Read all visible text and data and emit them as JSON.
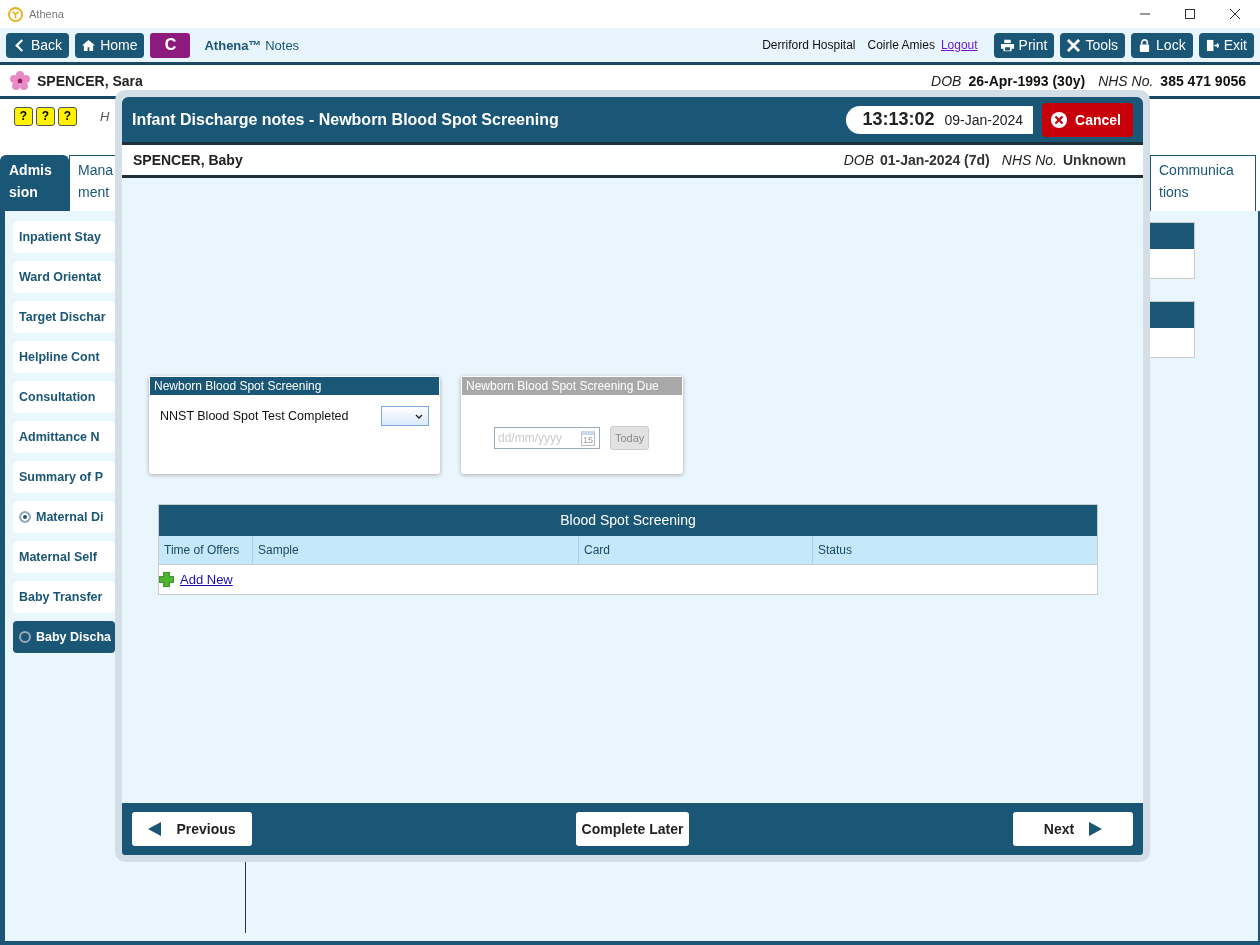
{
  "window": {
    "title": "Athena"
  },
  "toolbar": {
    "back": "Back",
    "home": "Home",
    "badge": "C",
    "app_name": "**Athena™** Notes",
    "hospital": "Derriford Hospital",
    "user": "Coirle Amies",
    "logout": "Logout",
    "buttons": [
      {
        "label": "Print",
        "kind": "print"
      },
      {
        "label": "Tools",
        "kind": "tools"
      },
      {
        "label": "Lock",
        "kind": "lock"
      },
      {
        "label": "Exit",
        "kind": "exit"
      }
    ]
  },
  "patient": {
    "name": "SPENCER, Sara",
    "dob_label": "DOB",
    "dob": "26-Apr-1993 (30y)",
    "nhs_label": "NHS No.",
    "nhs": "385 471 9056"
  },
  "alert_icons": [
    "?",
    "?",
    "?"
  ],
  "header_hint": "H",
  "tabs": [
    {
      "lines": [
        "Admis",
        "sion"
      ],
      "selected": true
    },
    {
      "lines": [
        "Mana",
        "ment"
      ],
      "selected": false
    },
    {
      "lines": [
        "Communica",
        "tions"
      ],
      "selected": false
    }
  ],
  "sidebar": {
    "items": [
      {
        "label": "Inpatient Stay",
        "kind": "plain",
        "selected": false
      },
      {
        "label": "Ward Orientat",
        "kind": "plain",
        "selected": false
      },
      {
        "label": "Target Dischar",
        "kind": "plain",
        "selected": false
      },
      {
        "label": "Helpline Cont",
        "kind": "plain",
        "selected": false
      },
      {
        "label": "Consultation",
        "kind": "plain",
        "selected": false
      },
      {
        "label": "Admittance N",
        "kind": "plain",
        "selected": false
      },
      {
        "label": "Summary of P",
        "kind": "plain",
        "selected": false
      },
      {
        "label": "Maternal Di",
        "kind": "radio",
        "checked": true,
        "selected": false
      },
      {
        "label": "Maternal Self",
        "kind": "plain",
        "selected": false
      },
      {
        "label": "Baby Transfer",
        "kind": "plain",
        "selected": false
      },
      {
        "label": "Baby Discha",
        "kind": "radio",
        "checked": false,
        "selected": true
      }
    ]
  },
  "dialog": {
    "title": "Infant Discharge notes - Newborn Blood Spot Screening",
    "time": "13:13:02",
    "date": "09-Jan-2024",
    "cancel": "Cancel",
    "baby": {
      "name": "SPENCER, Baby",
      "dob_label": "DOB",
      "dob": "01-Jan-2024 (7d)",
      "nhs_label": "NHS No.",
      "nhs": "Unknown"
    },
    "cards": [
      {
        "kind": "select",
        "title": "Newborn Blood Spot Screening",
        "disabled": false,
        "label": "NNST Blood Spot Test Completed"
      },
      {
        "kind": "date",
        "title": "Newborn Blood Spot Screening Due",
        "disabled": true,
        "placeholder": "dd/mm/yyyy",
        "calendar_day": "15",
        "today": "Today"
      }
    ],
    "table": {
      "title": "Blood Spot Screening",
      "columns": [
        "Time of Offers",
        "Sample",
        "Card",
        "Status"
      ],
      "add_new": "Add New"
    },
    "footer": {
      "previous": "Previous",
      "complete_later": "Complete Later",
      "next": "Next"
    }
  }
}
